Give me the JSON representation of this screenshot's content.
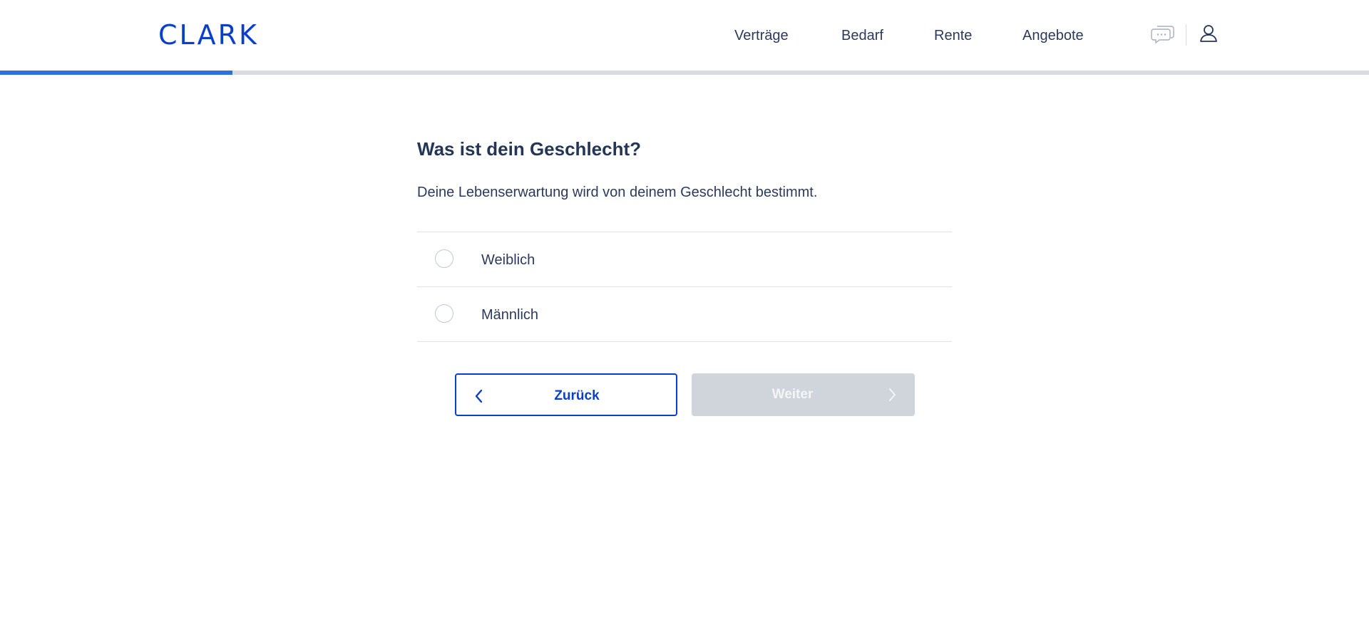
{
  "header": {
    "logo_text": "CLARK",
    "nav": [
      "Verträge",
      "Bedarf",
      "Rente",
      "Angebote"
    ],
    "icons": [
      "chat-icon",
      "user-icon"
    ]
  },
  "progress": {
    "fraction": 0.17
  },
  "question": {
    "title": "Was ist dein Geschlecht?",
    "subtitle": "Deine Lebenserwartung wird von deinem Geschlecht bestimmt.",
    "options": [
      {
        "label": "Weiblich",
        "selected": false
      },
      {
        "label": "Männlich",
        "selected": false
      }
    ]
  },
  "buttons": {
    "back_label": "Zurück",
    "next_label": "Weiter",
    "next_disabled": true
  },
  "colors": {
    "brand": "#0a3fcc",
    "progress": "#2e6fe0",
    "text": "#2b3a5c",
    "disabled_button": "#d0d4db"
  }
}
